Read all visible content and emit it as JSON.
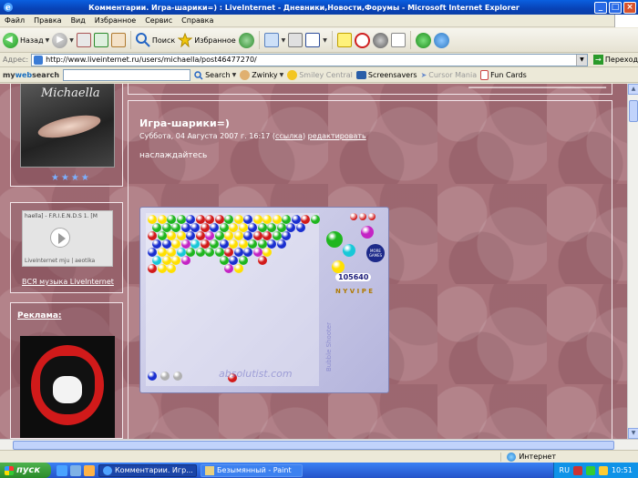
{
  "window": {
    "title": "Комментарии. Игра-шарики=) : LiveInternet - Дневники,Новости,Форумы - Microsoft Internet Explorer"
  },
  "menu": [
    "Файл",
    "Правка",
    "Вид",
    "Избранное",
    "Сервис",
    "Справка"
  ],
  "toolbar": {
    "back_label": "Назад",
    "search_label": "Поиск",
    "favorites_label": "Избранное"
  },
  "address": {
    "label": "Адрес:",
    "url": "http://www.liveinternet.ru/users/michaella/post46477270/",
    "go_label": "Переход"
  },
  "websearch": {
    "logo_my": "my",
    "logo_web": "web",
    "logo_search": "search",
    "search_button": "Search",
    "zwinky": "Zwinky",
    "smiley": "Smiley Central",
    "screensavers": "Screensavers",
    "cursor": "Cursor Mania",
    "funcards": "Fun Cards"
  },
  "sidebar": {
    "avatar_name": "Michaella",
    "stars": "★★★★",
    "player_track": "haella] - F.R.I.E.N.D.S 1. [M",
    "player_brand": "LiveInternet  mju | aeotika",
    "music_link": "ВСЯ музыка LiveInternet",
    "ad_title": "Реклама:"
  },
  "post": {
    "title": "Игра-шарики=)",
    "date": "Суббота, 04 Августа 2007 г. 16:17 (",
    "link": "ссылка",
    "date_close": ")",
    "edit": "редактировать",
    "body": "наслаждайтесь"
  },
  "game": {
    "score": "105640",
    "level": "N Y V I P E",
    "more_games": "MORE GAMES",
    "watermark": "absolutist.com",
    "side_text": "Bubble Shooter"
  },
  "statusbar": {
    "zone": "Интернет"
  },
  "taskbar": {
    "start": "пуск",
    "task1": "Комментарии. Игр...",
    "task2": "Безымянный - Paint",
    "lang": "RU",
    "clock": "10:51"
  },
  "colors": {
    "page_bg": "#a8727a",
    "ball_colors": [
      "#ffe000",
      "#1fb61f",
      "#1a2fd0",
      "#d21a1a",
      "#c424c4",
      "#18c8d8",
      "#b0b0b0"
    ]
  }
}
